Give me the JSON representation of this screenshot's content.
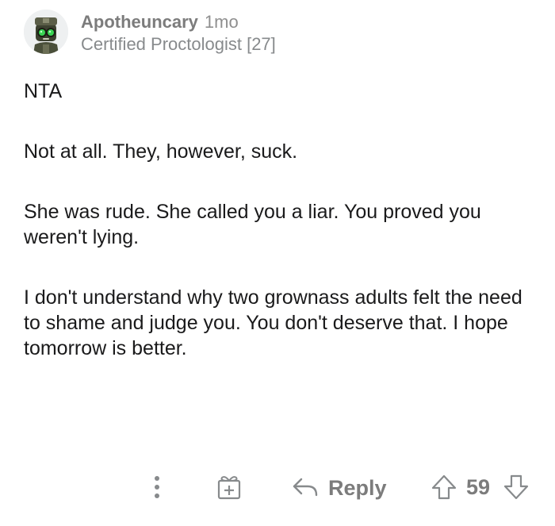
{
  "comment": {
    "author": "Apotheuncary",
    "age": "1mo",
    "flair": "Certified Proctologist [27]",
    "paragraphs": [
      "NTA",
      "Not at all. They, however, suck.",
      "She was rude. She called you a liar. You proved you weren't lying.",
      "I don't understand why two grownass adults felt the need to shame and judge you. You don't deserve that. I hope tomorrow is better."
    ]
  },
  "actions": {
    "more_icon": "vertical-dots-icon",
    "award_icon": "gift-award-icon",
    "reply_icon": "reply-arrow-icon",
    "reply_label": "Reply",
    "upvote_icon": "upvote-arrow-icon",
    "score": "59",
    "downvote_icon": "downvote-arrow-icon"
  },
  "colors": {
    "text": "#1a1a1b",
    "meta": "#7c7c7c",
    "icon": "#878a8c",
    "avatar_accent": "#39d353"
  }
}
